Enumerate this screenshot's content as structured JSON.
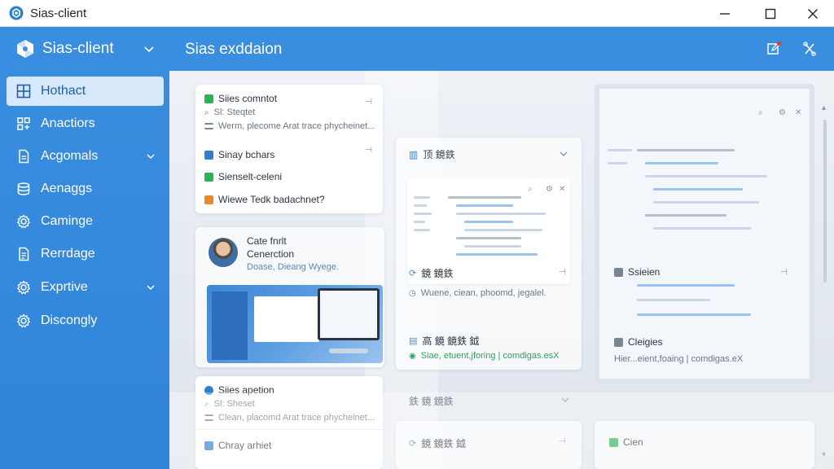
{
  "window": {
    "title": "Sias-client",
    "controls": [
      "minimize-icon",
      "maximize-icon",
      "close-icon"
    ]
  },
  "sidebar": {
    "app_name": "Sias-client",
    "items": [
      {
        "label": "Hothact",
        "icon": "grid-icon",
        "active": true,
        "has_chevron": false
      },
      {
        "label": "Anactiors",
        "icon": "apps-icon",
        "active": false,
        "has_chevron": false
      },
      {
        "label": "Acgomals",
        "icon": "document-icon",
        "active": false,
        "has_chevron": true
      },
      {
        "label": "Aenaggs",
        "icon": "database-icon",
        "active": false,
        "has_chevron": false
      },
      {
        "label": "Caminge",
        "icon": "gear-icon",
        "active": false,
        "has_chevron": false
      },
      {
        "label": "Rerrdage",
        "icon": "file-icon",
        "active": false,
        "has_chevron": false
      },
      {
        "label": "Exprtive",
        "icon": "gear-icon",
        "active": false,
        "has_chevron": true
      },
      {
        "label": "Discongly",
        "icon": "gear-icon",
        "active": false,
        "has_chevron": false
      }
    ]
  },
  "topbar": {
    "title": "Sias exddaion",
    "buttons": [
      "edit-icon",
      "tools-icon"
    ]
  },
  "col1": {
    "card1": {
      "rows": [
        {
          "text": "Siies comntot",
          "icon": "check-icon"
        },
        {
          "text": "Sl: Steqtet",
          "icon": "search-icon"
        },
        {
          "text": "Werm, plecome Arat trace phycheinet...",
          "icon": "list-icon"
        }
      ]
    },
    "card2": {
      "rows": [
        {
          "text": "Sinay bchars",
          "icon": "square-icon"
        },
        {
          "text": "Sienselt-celeni",
          "icon": "check-icon"
        },
        {
          "text": "Wiewe Tedk badachnet?",
          "icon": "folder-icon"
        }
      ]
    },
    "profile": {
      "name_line1": "Cate fnrlt",
      "name_line2": "Cenerction",
      "subtitle": "Doase, Dieang Wyege."
    },
    "card3": {
      "rows": [
        {
          "text": "Siies apetion",
          "icon": "circle-icon"
        },
        {
          "text": "Sl: Sheset",
          "icon": "search-icon"
        },
        {
          "text": "Clean, placomd Arat trace phycheinet...",
          "icon": "list-icon"
        },
        {
          "text": "Chray arhiet",
          "icon": "square-icon"
        }
      ]
    }
  },
  "col2": {
    "section1_title": "顶 鏡鉄",
    "preview_row": "鏡 鏡鉄",
    "info_row": "Wuene, ciean, phoomd, jegalel.",
    "lower_title": "高 鏡 鏡鉄 鉞",
    "lower_status": "Siae, etuent,jforing | comdigas.esX",
    "section2_title": "鉄 鏡 鏡鉄",
    "bottom_row": "鏡 鏡鉄 鉞"
  },
  "col3": {
    "row1": "Ssieien",
    "row2": "Cleigies",
    "status": "Hier...eient,foaing | comdigas.eX",
    "bottom_row": "Cien"
  },
  "colors": {
    "sidebar_bg": "#3a8ee0",
    "active_item_bg": "#d7e8fa",
    "active_item_text": "#1f5fa8",
    "accent_green": "#2fb15a",
    "accent_blue": "#2f7fd1",
    "accent_orange": "#e8892b",
    "notification_dot": "#e53935"
  }
}
